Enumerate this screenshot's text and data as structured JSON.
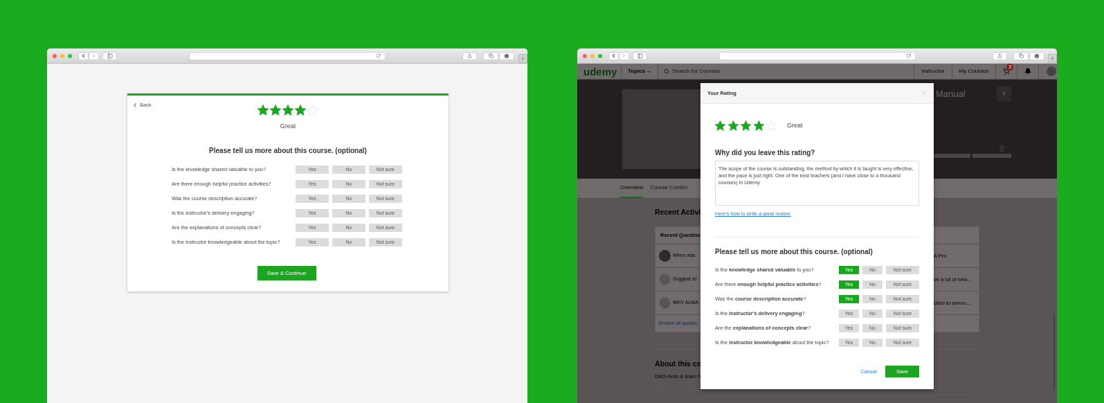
{
  "left_window": {
    "back_link": "Back",
    "rating": {
      "stars": 4,
      "label": "Great"
    },
    "survey": {
      "heading": "Please tell us more about this course. (optional)",
      "questions": [
        {
          "text": "Is the knowledge shared valuable to you?",
          "options": [
            {
              "label": "Yes",
              "selected": false
            },
            {
              "label": "No",
              "selected": false
            },
            {
              "label": "Not sure",
              "selected": false
            }
          ]
        },
        {
          "text": "Are there enough helpful practice activities?",
          "options": [
            {
              "label": "Yes",
              "selected": false
            },
            {
              "label": "No",
              "selected": false
            },
            {
              "label": "Not sure",
              "selected": false
            }
          ]
        },
        {
          "text": "Was the course description accurate?",
          "options": [
            {
              "label": "Yes",
              "selected": false
            },
            {
              "label": "No",
              "selected": false
            },
            {
              "label": "Not sure",
              "selected": false
            }
          ]
        },
        {
          "text": "Is the instructor's delivery engaging?",
          "options": [
            {
              "label": "Yes",
              "selected": false
            },
            {
              "label": "No",
              "selected": false
            },
            {
              "label": "Not sure",
              "selected": false
            }
          ]
        },
        {
          "text": "Are the explanations of concepts clear?",
          "options": [
            {
              "label": "Yes",
              "selected": false
            },
            {
              "label": "No",
              "selected": false
            },
            {
              "label": "Not sure",
              "selected": false
            }
          ]
        },
        {
          "text": "Is the instructor knowledgeable about the topic?",
          "options": [
            {
              "label": "Yes",
              "selected": false
            },
            {
              "label": "No",
              "selected": false
            },
            {
              "label": "Not sure",
              "selected": false
            }
          ]
        }
      ]
    },
    "submit_button": "Save & Continue"
  },
  "right_window": {
    "navbar": {
      "logo": "udemy",
      "topics": "Topics",
      "search_placeholder": "Search for Courses",
      "links": [
        "Instructor",
        "My Courses"
      ],
      "cart_badge": "3"
    },
    "hero": {
      "title": "Manual",
      "info_button": "i"
    },
    "tabs": [
      {
        "label": "Overview",
        "selected": true
      },
      {
        "label": "Course Conten",
        "selected": false
      }
    ],
    "content": {
      "section_title": "Recent Activi",
      "card": {
        "title": "Recent Question",
        "items": [
          {
            "kind": "photo",
            "left": "When was",
            "right": "A Pro"
          },
          {
            "kind": "default",
            "left": "Suggest sc",
            "right": "ve a lot of new..."
          },
          {
            "kind": "default",
            "left": "WHY ALWA",
            "right": "cited to annou..."
          }
        ],
        "link": "Browse all questio"
      },
      "about_title": "About this co",
      "about_text": "Ditch Auto & learn h"
    },
    "modal": {
      "title": "Your Rating",
      "rating": {
        "stars": 4,
        "label": "Great"
      },
      "review_heading": "Why did you leave this rating?",
      "review_text": "The scope of the course is outstanding, the method by which it is taught is very effective, and the pace is just right. One of the best teachers (and I have close to a thousand courses) in Udemy",
      "review_link": "Here’s how to write a great review.",
      "survey": {
        "heading": "Please tell us more about this course. (optional)",
        "questions": [
          {
            "text": "Is the **knowledge shared valuable** to you?",
            "options": [
              {
                "label": "Yes",
                "selected": true
              },
              {
                "label": "No",
                "selected": false
              },
              {
                "label": "Not sure",
                "selected": false
              }
            ]
          },
          {
            "text": "Are there **enough helpful practice activities**?",
            "options": [
              {
                "label": "Yes",
                "selected": true
              },
              {
                "label": "No",
                "selected": false
              },
              {
                "label": "Not sure",
                "selected": false
              }
            ]
          },
          {
            "text": "Was the **course description accurate**?",
            "options": [
              {
                "label": "Yes",
                "selected": true
              },
              {
                "label": "No",
                "selected": false
              },
              {
                "label": "Not sure",
                "selected": false
              }
            ]
          },
          {
            "text": "Is the **instructor's delivery engaging**?",
            "options": [
              {
                "label": "Yes",
                "selected": false
              },
              {
                "label": "No",
                "selected": false
              },
              {
                "label": "Not sure",
                "selected": false
              }
            ]
          },
          {
            "text": "Are the **explanations of concepts clear**?",
            "options": [
              {
                "label": "Yes",
                "selected": false
              },
              {
                "label": "No",
                "selected": false
              },
              {
                "label": "Not sure",
                "selected": false
              }
            ]
          },
          {
            "text": "Is the **instructor knowledgeable** about the topic?",
            "options": [
              {
                "label": "Yes",
                "selected": false
              },
              {
                "label": "No",
                "selected": false
              },
              {
                "label": "Not sure",
                "selected": false
              }
            ]
          }
        ]
      },
      "cancel_button": "Cancel",
      "save_button": "Save"
    }
  }
}
